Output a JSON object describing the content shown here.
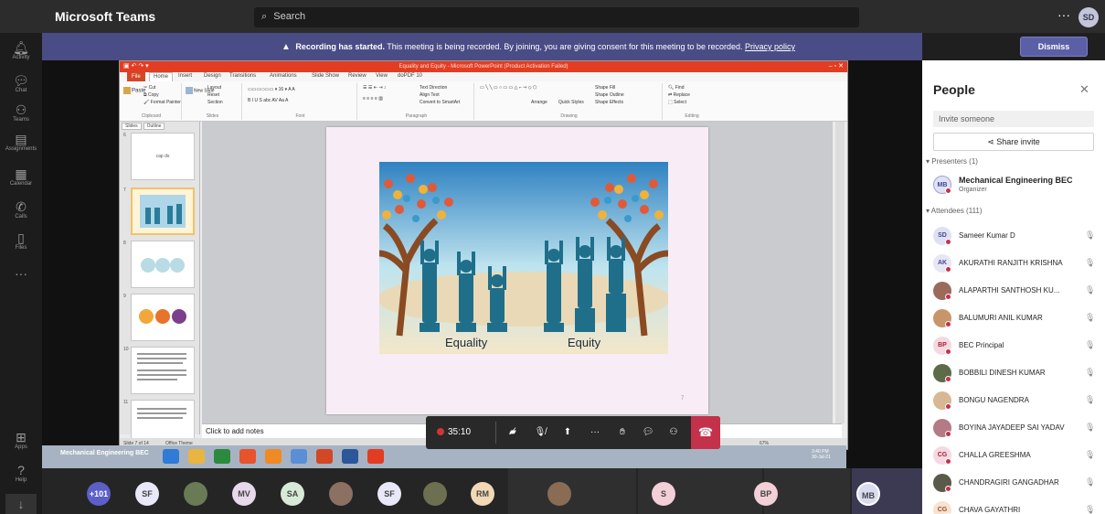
{
  "app": {
    "title": "Microsoft Teams"
  },
  "search": {
    "placeholder": "Search"
  },
  "me": {
    "initials": "SD"
  },
  "rail": [
    {
      "label": "Activity",
      "icon": "bell-icon"
    },
    {
      "label": "Chat",
      "icon": "chat-icon"
    },
    {
      "label": "Teams",
      "icon": "teams-icon"
    },
    {
      "label": "Assignments",
      "icon": "assignments-icon"
    },
    {
      "label": "Calendar",
      "icon": "calendar-icon"
    },
    {
      "label": "Calls",
      "icon": "phone-icon"
    },
    {
      "label": "Files",
      "icon": "file-icon"
    },
    {
      "label": "Apps",
      "icon": "apps-icon"
    },
    {
      "label": "Help",
      "icon": "help-icon"
    }
  ],
  "banner": {
    "bold": "Recording has started.",
    "text": " This meeting is being recorded. By joining, you are giving consent for this meeting to be recorded. ",
    "link": "Privacy policy",
    "dismiss": "Dismiss"
  },
  "ppt": {
    "title_bar": "Equality and Equity - Microsoft PowerPoint (Product Activation Failed)",
    "tabs": [
      "File",
      "Home",
      "Insert",
      "Design",
      "Transitions",
      "Animations",
      "Slide Show",
      "Review",
      "View",
      "doPDF 10"
    ],
    "ribbon_groups": [
      "Clipboard",
      "Slides",
      "Font",
      "Paragraph",
      "Drawing",
      "Editing"
    ],
    "ribbon_buttons": {
      "cut": "Cut",
      "copy": "Copy",
      "paste": "Paste",
      "format_painter": "Format Painter",
      "new_slide": "New Slide",
      "layout": "Layout",
      "reset": "Reset",
      "section": "Section",
      "text_direction": "Text Direction",
      "align_text": "Align Text",
      "smartart": "Convert to SmartArt",
      "arrange": "Arrange",
      "quick_styles": "Quick Styles",
      "shape_fill": "Shape Fill",
      "shape_outline": "Shape Outline",
      "shape_effects": "Shape Effects",
      "find": "Find",
      "replace": "Replace",
      "select": "Select"
    },
    "thumb_tabs": [
      "Slides",
      "Outline"
    ],
    "thumb_numbers": [
      "6",
      "7",
      "8",
      "9",
      "10",
      "11"
    ],
    "thumb_caption": "cap ds",
    "slide_labels": {
      "left": "Equality",
      "right": "Equity"
    },
    "slide_number": "7",
    "notes_placeholder": "Click to add notes",
    "status": {
      "slide": "Slide 7 of 14",
      "theme": "Office Theme",
      "zoom": "67%"
    }
  },
  "taskbar": {
    "label": "Mechanical Engineering BEC",
    "clock_time": "3:40 PM",
    "clock_date": "30-Jul-21",
    "toast": "teams.mic"
  },
  "controls": {
    "timer": "35:10"
  },
  "strip": [
    {
      "label": "+101",
      "color": "#5b5fc7"
    },
    {
      "label": "SF",
      "color": "#e8e8f8"
    },
    {
      "label": "",
      "color": "#6a7a54"
    },
    {
      "label": "MV",
      "color": "#e7d8ec"
    },
    {
      "label": "SA",
      "color": "#d7ead8"
    },
    {
      "label": "",
      "color": "#8c7062"
    },
    {
      "label": "SF",
      "color": "#e8e8f8"
    },
    {
      "label": "",
      "color": "#6d7050"
    },
    {
      "label": "RM",
      "color": "#f1d8b6"
    },
    {
      "label": "",
      "color": "#8a6b54"
    },
    {
      "label": "S",
      "color": "#f3cfd8"
    },
    {
      "label": "BP",
      "color": "#f3cfd8"
    },
    {
      "label": "MB",
      "color": "#d9dcf1"
    }
  ],
  "people": {
    "title": "People",
    "invite_placeholder": "Invite someone",
    "share_invite": "Share invite",
    "presenters_heading": "Presenters (1)",
    "organizer": {
      "initials": "MB",
      "name": "Mechanical Engineering BEC",
      "role": "Organizer"
    },
    "attendees_heading": "Attendees (111)",
    "attendees": [
      {
        "initials": "SD",
        "name": "Sameer Kumar D",
        "color": "#e0e0f5",
        "fg": "#444791"
      },
      {
        "initials": "AK",
        "name": "AKURATHI RANJITH KRISHNA",
        "color": "#e6e6f5",
        "fg": "#444791"
      },
      {
        "initials": "",
        "name": "ALAPARTHI SANTHOSH KU...",
        "color": "#9b6a5a",
        "fg": "#fff"
      },
      {
        "initials": "",
        "name": "BALUMURI ANIL KUMAR",
        "color": "#c8956a",
        "fg": "#fff"
      },
      {
        "initials": "BP",
        "name": "BEC Principal",
        "color": "#f5d8e2",
        "fg": "#a4262c"
      },
      {
        "initials": "",
        "name": "BOBBILI DINESH KUMAR",
        "color": "#5c6b4a",
        "fg": "#fff"
      },
      {
        "initials": "",
        "name": "BONGU NAGENDRA",
        "color": "#d8b894",
        "fg": "#fff"
      },
      {
        "initials": "",
        "name": "BOYINA JAYADEEP SAI YADAV",
        "color": "#b47a86",
        "fg": "#fff"
      },
      {
        "initials": "CG",
        "name": "CHALLA GREESHMA",
        "color": "#f5d8e2",
        "fg": "#a4262c"
      },
      {
        "initials": "",
        "name": "CHANDRAGIRI GANGADHAR",
        "color": "#5a5a4a",
        "fg": "#fff"
      },
      {
        "initials": "CG",
        "name": "CHAVA GAYATHRI",
        "color": "#f9e2cf",
        "fg": "#8e562e"
      }
    ]
  }
}
